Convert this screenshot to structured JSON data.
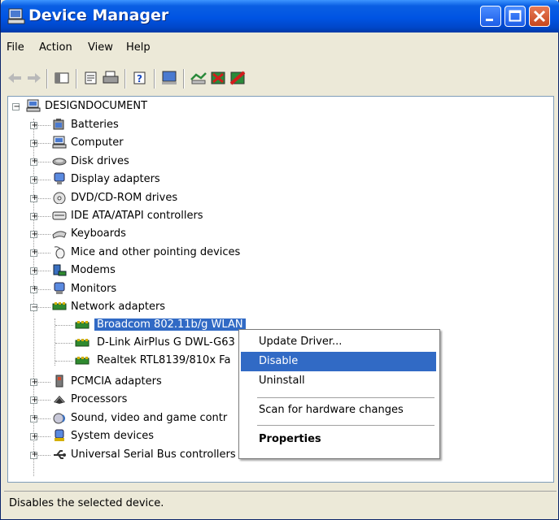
{
  "window": {
    "title": "Device Manager"
  },
  "menu": [
    "File",
    "Action",
    "View",
    "Help"
  ],
  "tree": {
    "root": "DESIGNDOCUMENT",
    "items": [
      {
        "label": "Batteries",
        "icon": "battery-icon"
      },
      {
        "label": "Computer",
        "icon": "computer-icon"
      },
      {
        "label": "Disk drives",
        "icon": "disk-drive-icon"
      },
      {
        "label": "Display adapters",
        "icon": "display-adapter-icon"
      },
      {
        "label": "DVD/CD-ROM drives",
        "icon": "cdrom-icon"
      },
      {
        "label": "IDE ATA/ATAPI controllers",
        "icon": "ide-controller-icon"
      },
      {
        "label": "Keyboards",
        "icon": "keyboard-icon"
      },
      {
        "label": "Mice and other pointing devices",
        "icon": "mouse-icon"
      },
      {
        "label": "Modems",
        "icon": "modem-icon"
      },
      {
        "label": "Monitors",
        "icon": "monitor-icon"
      },
      {
        "label": "Network adapters",
        "icon": "network-adapter-icon"
      }
    ],
    "network_children": [
      {
        "label": "Broadcom 802.11b/g WLAN"
      },
      {
        "label": "D-Link AirPlus G DWL-G63"
      },
      {
        "label": "Realtek RTL8139/810x Fa"
      }
    ],
    "items_after": [
      {
        "label": "PCMCIA adapters",
        "icon": "pcmcia-icon"
      },
      {
        "label": "Processors",
        "icon": "processor-icon"
      },
      {
        "label": "Sound, video and game contr",
        "icon": "sound-icon"
      },
      {
        "label": "System devices",
        "icon": "system-devices-icon"
      },
      {
        "label": "Universal Serial Bus controllers",
        "icon": "usb-icon"
      }
    ]
  },
  "context_menu": {
    "update_driver": "Update Driver...",
    "disable": "Disable",
    "uninstall": "Uninstall",
    "scan": "Scan for hardware changes",
    "properties": "Properties"
  },
  "status": "Disables the selected device.",
  "colors": {
    "selection": "#316ac5",
    "titlebar": "#0054e3"
  }
}
